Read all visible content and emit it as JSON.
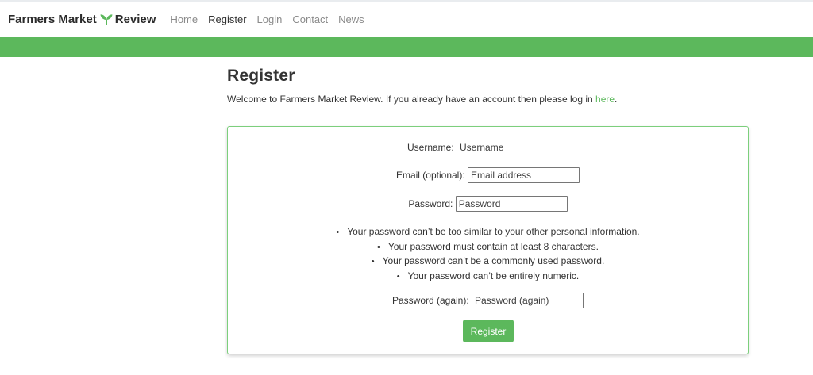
{
  "brand": {
    "name_part1": "Farmers Market",
    "name_part2": "Review",
    "logo_icon": "sprout-icon",
    "logo_color": "#5cb85c"
  },
  "nav": {
    "items": [
      {
        "label": "Home",
        "active": false
      },
      {
        "label": "Register",
        "active": true
      },
      {
        "label": "Login",
        "active": false
      },
      {
        "label": "Contact",
        "active": false
      },
      {
        "label": "News",
        "active": false
      }
    ]
  },
  "colors": {
    "accent": "#5cb85c",
    "text": "#333333",
    "nav_muted": "#8a8a8a"
  },
  "page": {
    "title": "Register",
    "welcome_text": "Welcome to Farmers Market Review. If you already have an account then please log in ",
    "welcome_link": "here",
    "welcome_end": "."
  },
  "form": {
    "username": {
      "label": "Username:",
      "placeholder": "Username",
      "value": ""
    },
    "email": {
      "label": "Email (optional):",
      "placeholder": "Email address",
      "value": ""
    },
    "password": {
      "label": "Password:",
      "placeholder": "Password",
      "value": ""
    },
    "password_rules": [
      "Your password can’t be too similar to your other personal information.",
      "Your password must contain at least 8 characters.",
      "Your password can’t be a commonly used password.",
      "Your password can’t be entirely numeric."
    ],
    "password_again": {
      "label": "Password (again):",
      "placeholder": "Password (again)",
      "value": ""
    },
    "submit_label": "Register"
  }
}
